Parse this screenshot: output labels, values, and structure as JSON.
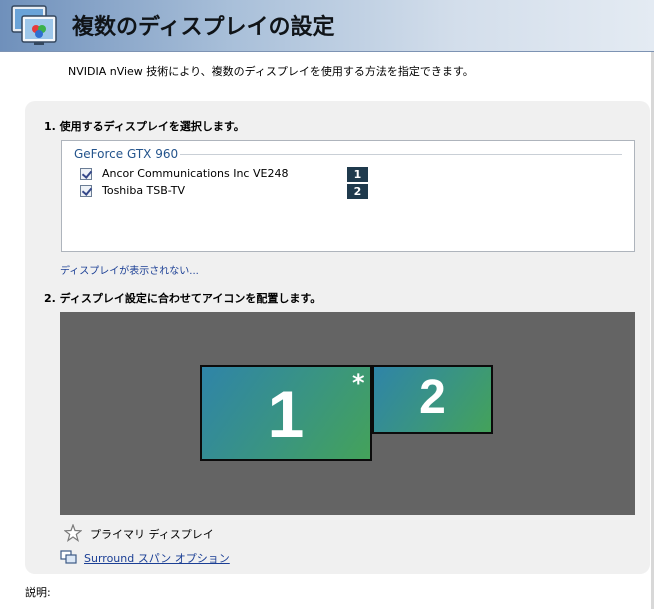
{
  "header": {
    "title": "複数のディスプレイの設定",
    "icon": "multi-display-icon"
  },
  "subtitle": "NVIDIA nView 技術により、複数のディスプレイを使用する方法を指定できます。",
  "step1": {
    "heading": "1. 使用するディスプレイを選択します。",
    "gpu_name": "GeForce GTX 960",
    "displays": [
      {
        "label": "Ancor Communications Inc VE248",
        "checked": true,
        "number": "1"
      },
      {
        "label": "Toshiba TSB-TV",
        "checked": true,
        "number": "2"
      }
    ],
    "missing_link": "ディスプレイが表示されない..."
  },
  "step2": {
    "heading": "2. ディスプレイ設定に合わせてアイコンを配置します。",
    "monitors": [
      {
        "number": "1",
        "primary": true
      },
      {
        "number": "2",
        "primary": false
      }
    ],
    "primary_marker": "*",
    "legend_label": "プライマリ ディスプレイ",
    "surround_link": "Surround スパン オプション"
  },
  "description_label": "説明:",
  "colors": {
    "header_start": "#6f90bb",
    "header_end": "#e4ebf3",
    "badge": "#1f3a4d",
    "canvas_bg": "#646464",
    "monitor_start": "#2f84a8",
    "monitor_end": "#44a25a",
    "link": "#1b3f95"
  }
}
